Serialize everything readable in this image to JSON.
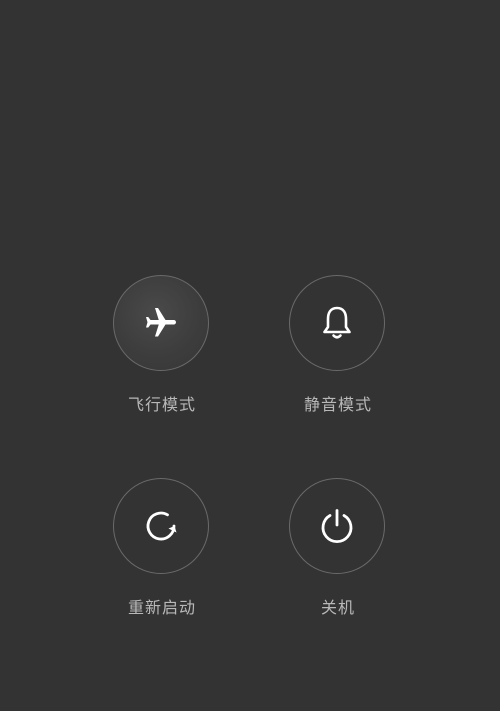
{
  "power_menu": {
    "options": [
      {
        "label": "飞行模式",
        "icon": "airplane-icon"
      },
      {
        "label": "静音模式",
        "icon": "bell-icon"
      },
      {
        "label": "重新启动",
        "icon": "restart-icon"
      },
      {
        "label": "关机",
        "icon": "power-icon"
      }
    ]
  },
  "colors": {
    "background": "#333333",
    "circle_border": "#6a6a6a",
    "icon": "#ffffff",
    "label": "#b8b8b8"
  }
}
